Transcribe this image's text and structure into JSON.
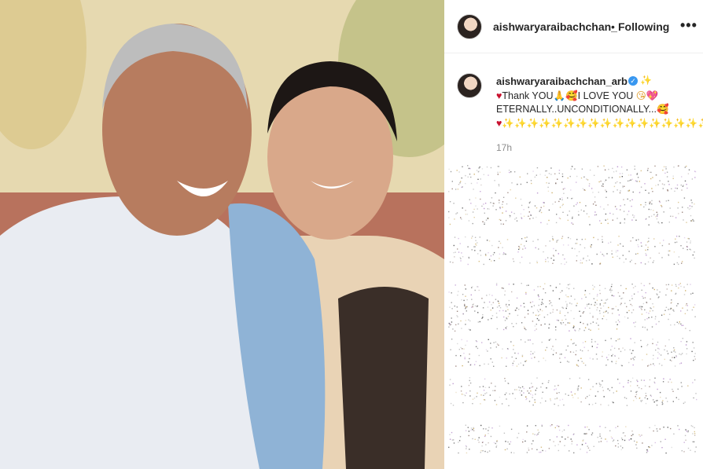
{
  "post_image": {
    "alt": ""
  },
  "header": {
    "username": "aishwaryaraibachchan_",
    "separator": "•",
    "follow_status": "Following",
    "more_label": "•••"
  },
  "caption": {
    "username": "aishwaryaraibachchan_arb",
    "verified_mark": "✓",
    "sparkle": "✨",
    "line1_heart": "♥",
    "line1_text": "Thank YOU",
    "line1_emoji1": "🙏",
    "line1_emoji2": "🥰",
    "line1_text2": "I LOVE YOU",
    "line1_emoji3": "😘",
    "line1_heart2": "💖",
    "line2_text": "ETERNALLY..UNCONDITIONALLY...",
    "line2_emoji": "🥰",
    "line3_heart": "♥",
    "line3_sparkles": "✨✨✨✨✨✨✨✨✨✨✨✨✨✨✨✨✨"
  },
  "timestamp": "17h",
  "colors": {
    "text": "#262626",
    "muted": "#8e8e8e",
    "verified": "#3897f0",
    "heart": "#c8102e"
  }
}
